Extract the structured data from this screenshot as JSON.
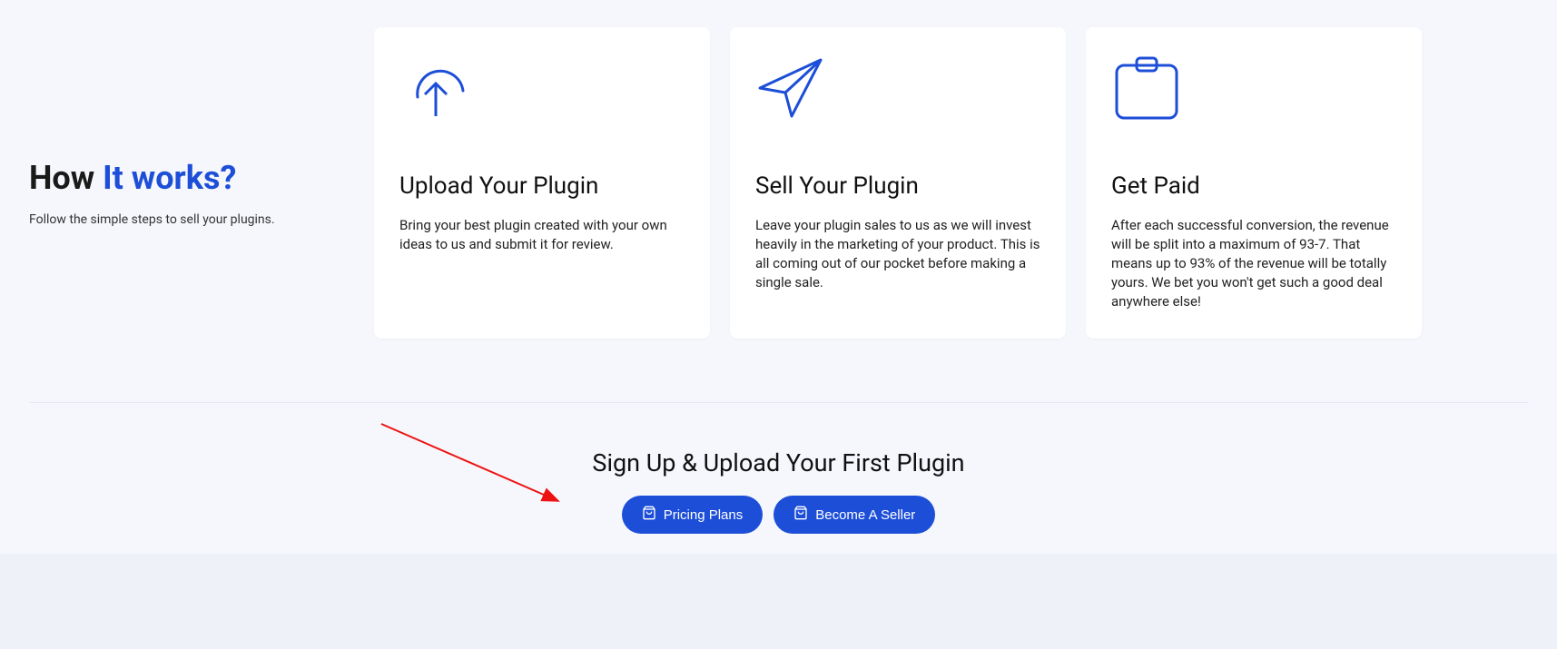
{
  "heading": {
    "part1": "How ",
    "part2": "It works?"
  },
  "subtitle": "Follow the simple steps to sell your plugins.",
  "cards": [
    {
      "title": "Upload Your Plugin",
      "body": "Bring your best plugin created with your own ideas to us and submit it for review."
    },
    {
      "title": "Sell Your Plugin",
      "body": "Leave your plugin sales to us as we will invest heavily in the marketing of your product. This is all coming out of our pocket before making a single sale."
    },
    {
      "title": "Get Paid",
      "body": "After each successful conversion, the revenue will be split into a maximum of 93-7. That means up to 93% of the revenue will be totally yours. We bet you won't get such a good deal anywhere else!"
    }
  ],
  "cta": {
    "heading": "Sign Up & Upload Your First Plugin",
    "pricing_label": "Pricing Plans",
    "seller_label": "Become A Seller"
  }
}
